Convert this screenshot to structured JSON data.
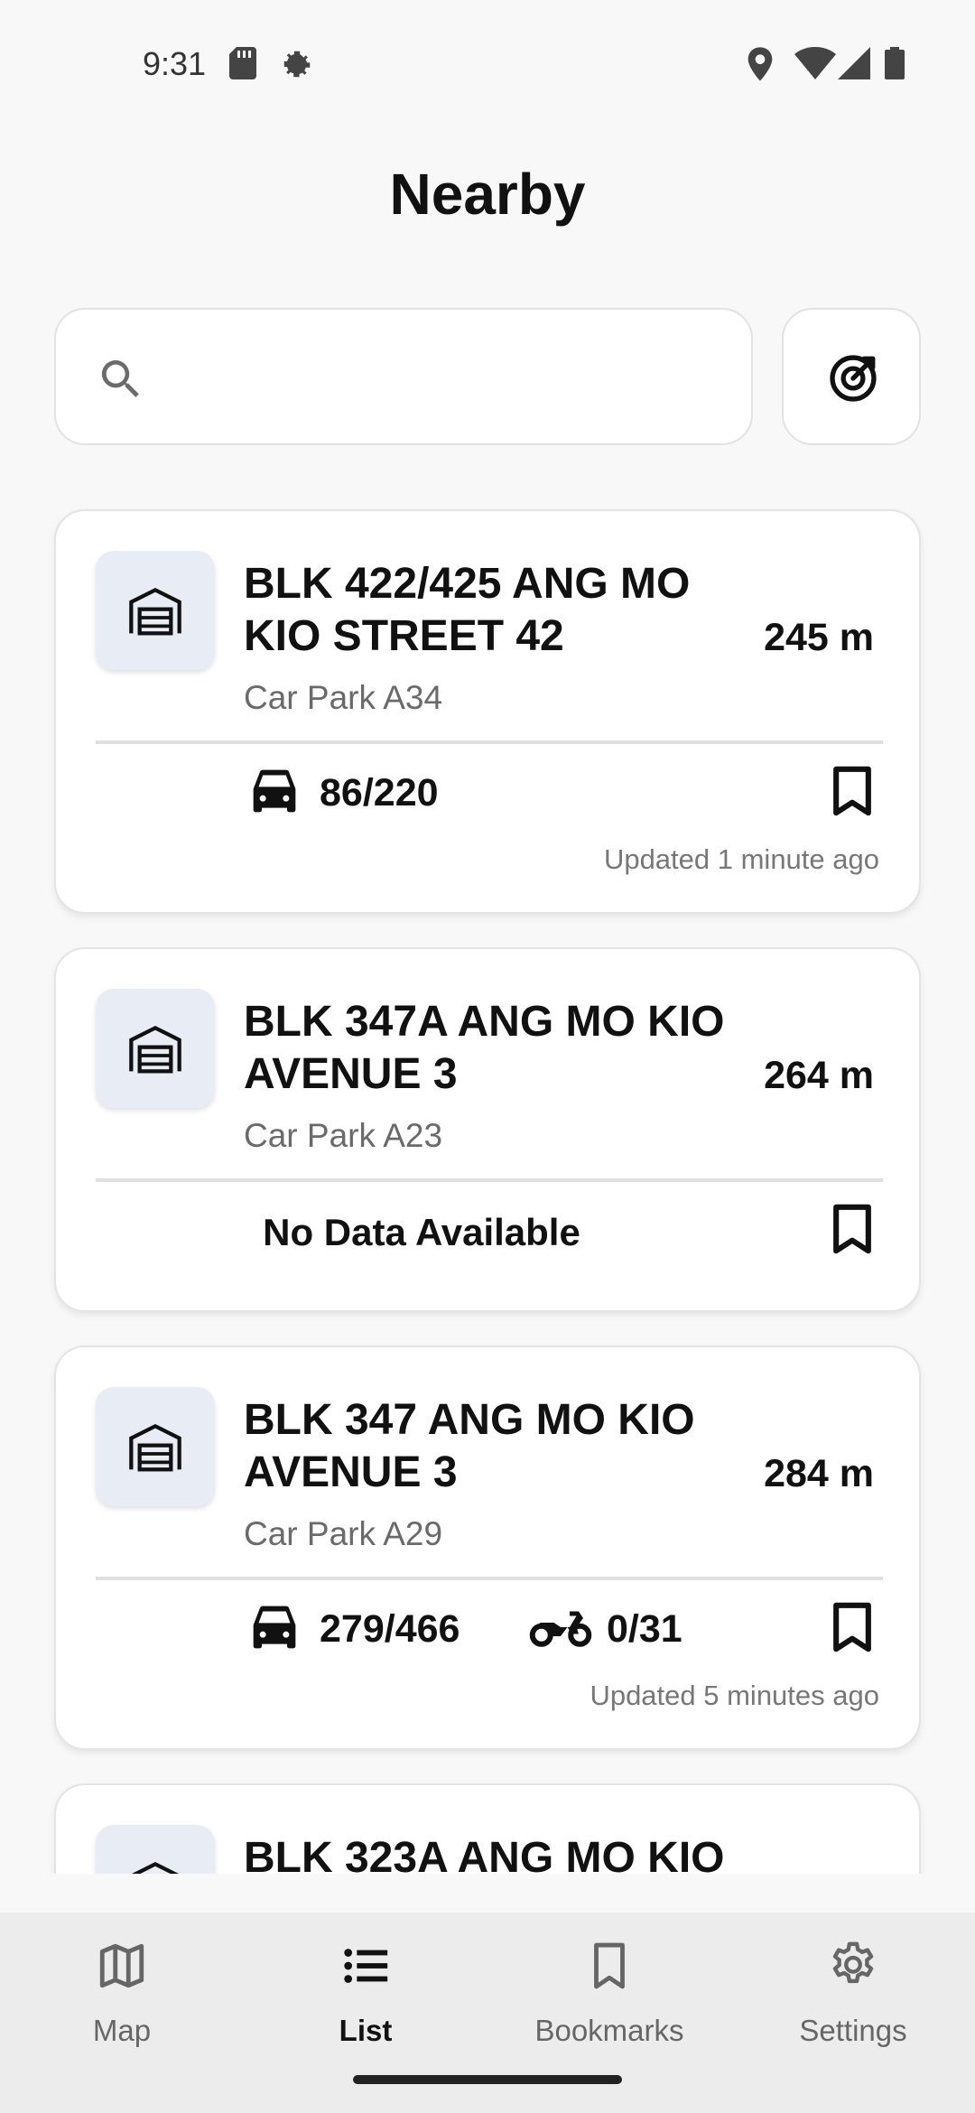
{
  "status_bar": {
    "time": "9:31",
    "icons_left": [
      "sd-card-icon",
      "settings-gear-icon"
    ],
    "icons_right": [
      "location-pin-icon",
      "wifi-icon",
      "cell-signal-icon",
      "battery-icon"
    ]
  },
  "header": {
    "title": "Nearby"
  },
  "search": {
    "value": "",
    "placeholder": ""
  },
  "carparks": [
    {
      "title": "BLK 422/425 ANG MO KIO STREET 42",
      "subtitle": "Car Park A34",
      "distance": "245 m",
      "car_lots": "86/220",
      "bookmarked": false,
      "updated": "Updated 1 minute ago"
    },
    {
      "title": "BLK 347A ANG MO KIO AVENUE 3",
      "subtitle": "Car Park A23",
      "distance": "264 m",
      "no_data": "No Data Available",
      "bookmarked": false
    },
    {
      "title": "BLK 347 ANG MO KIO AVENUE 3",
      "subtitle": "Car Park A29",
      "distance": "284 m",
      "car_lots": "279/466",
      "motorcycle_lots": "0/31",
      "bookmarked": false,
      "updated": "Updated 5 minutes ago"
    },
    {
      "title": "BLK 323A ANG MO KIO"
    }
  ],
  "bottom_nav": {
    "items": [
      {
        "label": "Map",
        "icon": "map-icon",
        "active": false
      },
      {
        "label": "List",
        "icon": "list-icon",
        "active": true
      },
      {
        "label": "Bookmarks",
        "icon": "bookmark-icon",
        "active": false
      },
      {
        "label": "Settings",
        "icon": "settings-icon",
        "active": false
      }
    ]
  },
  "colors": {
    "background": "#f8f8f8",
    "card": "#ffffff",
    "icon_tile": "#e8ecf4",
    "nav_bar": "#ececec",
    "text_primary": "#111111",
    "text_secondary": "#6a6a6a"
  }
}
